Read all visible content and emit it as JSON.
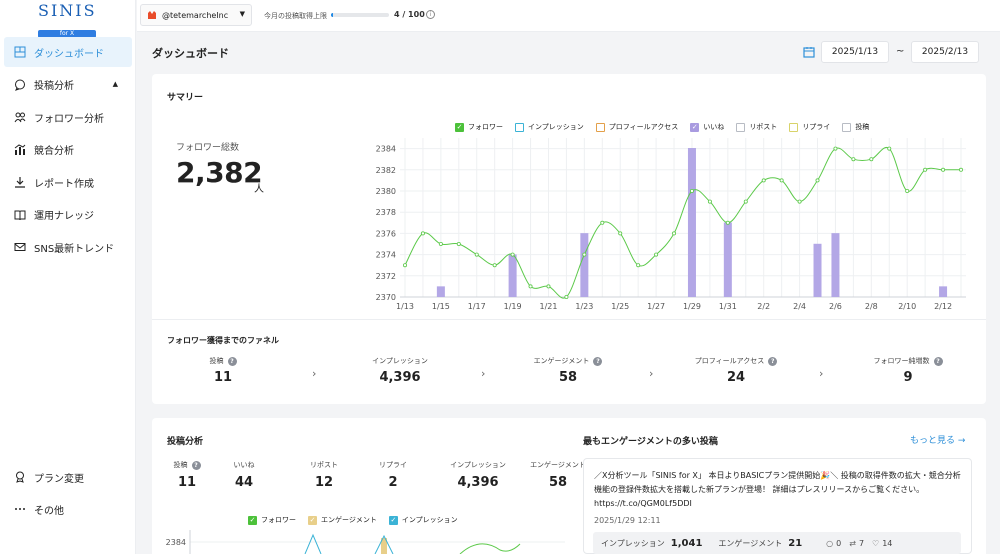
{
  "logo": {
    "name": "SINIS",
    "badge": "for X"
  },
  "topbar": {
    "account": "@tetemarcheInc",
    "quota_label": "今月の投稿取得上限",
    "quota_value": "4 / 100",
    "quota_fraction": 0.04,
    "info": "i"
  },
  "nav": {
    "items": [
      {
        "label": "ダッシュボード",
        "icon": "dashboard-icon",
        "active": true
      },
      {
        "label": "投稿分析",
        "icon": "speech-bubble-icon",
        "active": false
      },
      {
        "label": "フォロワー分析",
        "icon": "users-icon",
        "active": false
      },
      {
        "label": "競合分析",
        "icon": "bar-chart-icon",
        "active": false
      },
      {
        "label": "レポート作成",
        "icon": "download-icon",
        "active": false
      },
      {
        "label": "運用ナレッジ",
        "icon": "book-icon",
        "active": false
      },
      {
        "label": "SNS最新トレンド",
        "icon": "mail-icon",
        "active": false
      }
    ],
    "bottom": [
      {
        "label": "プラン変更",
        "icon": "badge-icon"
      },
      {
        "label": "その他",
        "icon": "more-icon"
      }
    ]
  },
  "page": {
    "title": "ダッシュボード",
    "date_from": "2025/1/13",
    "date_sep": "~",
    "date_to": "2025/2/13"
  },
  "summary": {
    "title": "サマリー",
    "follower_label": "フォロワー総数",
    "follower_value": "2,382",
    "follower_unit": "人"
  },
  "legend": [
    {
      "label": "フォロワー",
      "color": "#4cc13a",
      "checked": true
    },
    {
      "label": "インプレッション",
      "color": "#3bb3d6",
      "checked": false
    },
    {
      "label": "プロフィールアクセス",
      "color": "#e3a04a",
      "checked": false
    },
    {
      "label": "いいね",
      "color": "#a99be0",
      "checked": true
    },
    {
      "label": "リポスト",
      "color": "#b8bcc4",
      "checked": false
    },
    {
      "label": "リプライ",
      "color": "#d8d36a",
      "checked": false
    },
    {
      "label": "投稿",
      "color": "#b8bcc4",
      "checked": false
    }
  ],
  "funnel": {
    "title": "フォロワー獲得までのファネル",
    "help": "?",
    "chevron": "›",
    "steps": [
      {
        "label": "投稿",
        "value": "11"
      },
      {
        "label": "インプレッション",
        "value": "4,396"
      },
      {
        "label": "エンゲージメント",
        "value": "58"
      },
      {
        "label": "プロフィールアクセス",
        "value": "24"
      },
      {
        "label": "フォロワー純増数",
        "value": "9"
      }
    ]
  },
  "post_analysis": {
    "title": "投稿分析",
    "stats": [
      {
        "label": "投稿",
        "value": "11",
        "help": true
      },
      {
        "label": "いいね",
        "value": "44"
      },
      {
        "label": "リポスト",
        "value": "12"
      },
      {
        "label": "リプライ",
        "value": "2"
      },
      {
        "label": "インプレッション",
        "value": "4,396"
      },
      {
        "label": "エンゲージメント",
        "value": "58"
      }
    ],
    "legend": [
      {
        "label": "フォロワー",
        "color": "#4cc13a"
      },
      {
        "label": "エンゲージメント",
        "color": "#e8cf8a"
      },
      {
        "label": "インプレッション",
        "color": "#3bb3d6"
      }
    ],
    "ytick": "2384"
  },
  "top_post": {
    "title": "最もエンゲージメントの多い投稿",
    "more": "もっと見る →",
    "text": "／X分析ツール「SINIS for X」 本日よりBASICプラン提供開始🎉＼ 投稿の取得件数の拡大・競合分析機能の登録件数拡大を搭載した新プランが登場！ 詳細はプレスリリースからご覧ください。 https://t.co/QGM0Lf5DDI",
    "date": "2025/1/29 12:11",
    "impressions_label": "インプレッション",
    "impressions": "1,041",
    "engagement_label": "エンゲージメント",
    "engagement": "21",
    "replies": "0",
    "reposts": "7",
    "likes": "14"
  },
  "chart_data": {
    "type": "line",
    "x": [
      "1/13",
      "1/14",
      "1/15",
      "1/16",
      "1/17",
      "1/18",
      "1/19",
      "1/20",
      "1/21",
      "1/22",
      "1/23",
      "1/24",
      "1/25",
      "1/26",
      "1/27",
      "1/28",
      "1/29",
      "1/30",
      "1/31",
      "2/1",
      "2/2",
      "2/3",
      "2/4",
      "2/5",
      "2/6",
      "2/7",
      "2/8",
      "2/9",
      "2/10",
      "2/11",
      "2/12",
      "2/13"
    ],
    "xticks": [
      "1/13",
      "1/15",
      "1/17",
      "1/19",
      "1/21",
      "1/23",
      "1/25",
      "1/27",
      "1/29",
      "1/31",
      "2/2",
      "2/4",
      "2/6",
      "2/8",
      "2/10",
      "2/12"
    ],
    "yticks": [
      2370,
      2372,
      2374,
      2376,
      2378,
      2380,
      2382,
      2384
    ],
    "ylim": [
      2370,
      2385
    ],
    "series": [
      {
        "name": "フォロワー",
        "type": "line",
        "color": "#5cc94a",
        "values": [
          2373,
          2376,
          2375,
          2375,
          2374,
          2373,
          2374,
          2371,
          2371,
          2370,
          2374,
          2377,
          2376,
          2373,
          2374,
          2376,
          2380,
          2379,
          2377,
          2379,
          2381,
          2381,
          2379,
          2381,
          2384,
          2383,
          2383,
          2384,
          2380,
          2382,
          2382,
          2382
        ]
      },
      {
        "name": "いいね",
        "type": "bar",
        "color": "#b3a7e6",
        "values": [
          0,
          0,
          1,
          0,
          0,
          0,
          4,
          0,
          0,
          0,
          6,
          0,
          0,
          0,
          0,
          0,
          14,
          0,
          7,
          0,
          0,
          0,
          0,
          5,
          6,
          0,
          0,
          0,
          0,
          0,
          1,
          0
        ]
      }
    ],
    "grid": true
  }
}
